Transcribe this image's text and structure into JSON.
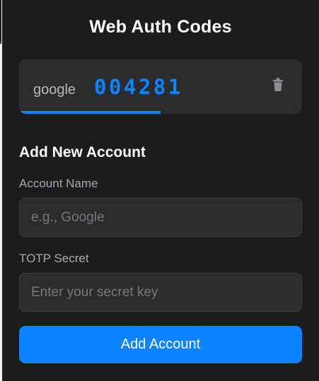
{
  "app": {
    "title": "Web Auth Codes"
  },
  "accounts": [
    {
      "name": "google",
      "code": "004281",
      "progress_fraction": 0.5,
      "delete_icon": "trash-icon"
    }
  ],
  "add_form": {
    "heading": "Add New Account",
    "name_label": "Account Name",
    "name_placeholder": "e.g., Google",
    "name_value": "",
    "secret_label": "TOTP Secret",
    "secret_placeholder": "Enter your secret key",
    "secret_value": "",
    "submit_label": "Add Account"
  },
  "colors": {
    "background": "#1c1c1e",
    "card": "#2c2c2e",
    "accent": "#0a84ff",
    "muted_text": "#a8a8ad"
  }
}
